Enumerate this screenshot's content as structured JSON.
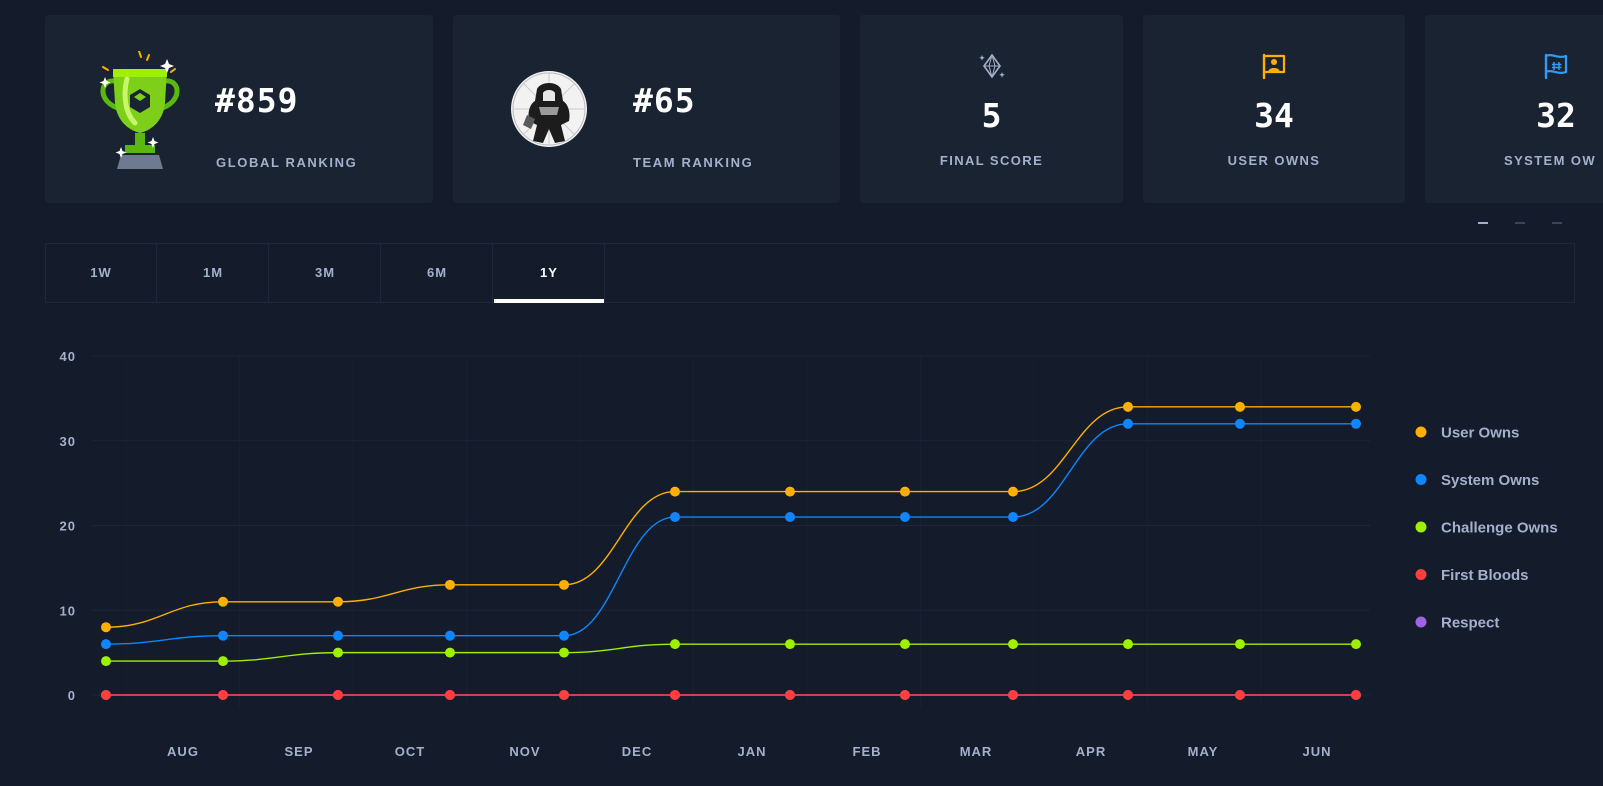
{
  "cards": {
    "global": {
      "value": "#859",
      "label": "GLOBAL RANKING"
    },
    "team": {
      "value": "#65",
      "label": "TEAM RANKING"
    },
    "stats": [
      {
        "value": "5",
        "label": "FINAL SCORE",
        "icon": "diamond-icon",
        "color": "#a4b1cd"
      },
      {
        "value": "34",
        "label": "USER OWNS",
        "icon": "user-flag-icon",
        "color": "#ffaf00"
      },
      {
        "value": "32",
        "label": "SYSTEM OW",
        "icon": "system-flag-icon",
        "color": "#2e9cff"
      }
    ]
  },
  "tabs": [
    "1W",
    "1M",
    "3M",
    "6M",
    "1Y"
  ],
  "active_tab": "1Y",
  "colors": {
    "background": "#141b2a",
    "card": "#1a2332",
    "user_owns": "#ffaf00",
    "system_owns": "#0d86ff",
    "challenge_owns": "#9fef00",
    "first_bloods": "#ff3e3e",
    "respect": "#9f63e3"
  },
  "chart_data": {
    "type": "line",
    "x_tick_labels": [
      "AUG",
      "SEP",
      "OCT",
      "NOV",
      "DEC",
      "JAN",
      "FEB",
      "MAR",
      "APR",
      "MAY",
      "JUN"
    ],
    "y_ticks": [
      0,
      10,
      20,
      30,
      40
    ],
    "ylim": [
      0,
      40
    ],
    "grid": true,
    "legend_placement": "right",
    "series": [
      {
        "name": "User Owns",
        "color": "#ffaf00",
        "values": [
          8,
          11,
          11,
          13,
          13,
          24,
          24,
          24,
          24,
          34,
          34,
          34
        ]
      },
      {
        "name": "System Owns",
        "color": "#0d86ff",
        "values": [
          6,
          7,
          7,
          7,
          7,
          21,
          21,
          21,
          21,
          32,
          32,
          32
        ]
      },
      {
        "name": "Challenge Owns",
        "color": "#9fef00",
        "values": [
          4,
          4,
          5,
          5,
          5,
          6,
          6,
          6,
          6,
          6,
          6,
          6
        ]
      },
      {
        "name": "First Bloods",
        "color": "#ff3e3e",
        "values": [
          0,
          0,
          0,
          0,
          0,
          0,
          0,
          0,
          0,
          0,
          0,
          0
        ]
      },
      {
        "name": "Respect",
        "color": "#9f63e3",
        "values": [
          0,
          0,
          0,
          0,
          0,
          0,
          0,
          0,
          0,
          0,
          0,
          0
        ]
      }
    ]
  }
}
